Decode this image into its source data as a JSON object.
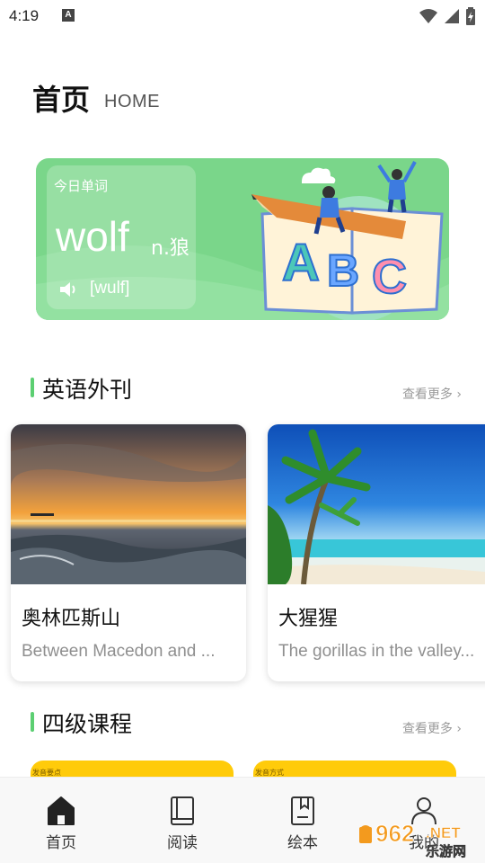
{
  "status_bar": {
    "time": "4:19",
    "notification_icon": "A",
    "icons": [
      "wifi-icon",
      "signal-icon",
      "battery-icon"
    ]
  },
  "header": {
    "title": "首页",
    "subtitle": "HOME"
  },
  "word_card": {
    "label": "今日单词",
    "word": "wolf",
    "part_of_speech": "n.狼",
    "phonetic": "[wulf]",
    "icon": "speaker-icon",
    "illustration": "abc-book-illustration"
  },
  "section_english": {
    "title": "英语外刊",
    "more": "查看更多 ›"
  },
  "articles": [
    {
      "title": "奥林匹斯山",
      "desc": "Between Macedon and ...",
      "image": "sunset-sea-photo"
    },
    {
      "title": "大猩猩",
      "desc": "The gorillas in the valley...",
      "image": "tropical-beach-photo"
    }
  ],
  "section_cet4": {
    "title": "四级课程",
    "more": "查看更多 ›"
  },
  "courses": [
    {
      "label": "发音要点"
    },
    {
      "label": "发音方式"
    }
  ],
  "bottom_nav": {
    "items": [
      {
        "label": "首页",
        "icon": "home-icon",
        "active": true
      },
      {
        "label": "阅读",
        "icon": "book-icon",
        "active": false
      },
      {
        "label": "绘本",
        "icon": "picture-book-icon",
        "active": false
      },
      {
        "label": "我的",
        "icon": "profile-icon",
        "active": false
      }
    ]
  },
  "watermark": {
    "brand": "962.NET",
    "site": "乐游网"
  },
  "colors": {
    "accent_green": "#5ccf72",
    "word_card_bg": "#7ad68a",
    "course_yellow": "#ffcb0a",
    "watermark_orange": "#f39a1e"
  }
}
